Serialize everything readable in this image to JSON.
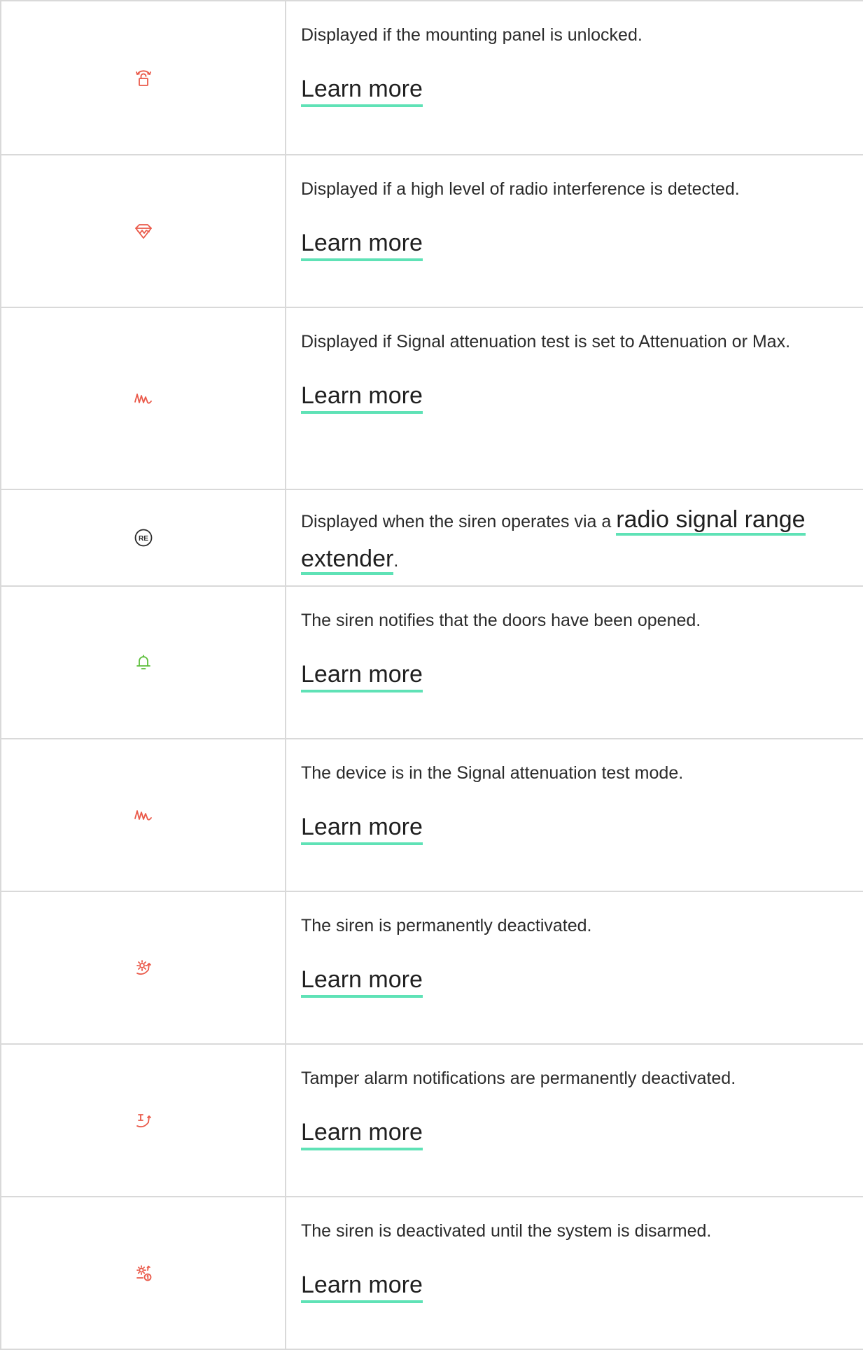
{
  "colors": {
    "accent_underline": "#5fe2b6",
    "icon_red": "#ea5a4a",
    "icon_green": "#5cbf3a",
    "icon_dark": "#2b2b2b",
    "border": "#d9d9d9"
  },
  "rows": [
    {
      "icon": "unlocked-mounting-panel-icon",
      "description": "Displayed if the mounting panel is unlocked.",
      "link": "Learn more"
    },
    {
      "icon": "radio-interference-icon",
      "description": "Displayed if a high level of radio interference is detected.",
      "link": "Learn more"
    },
    {
      "icon": "signal-attenuation-icon",
      "description": "Displayed if Signal attenuation test is set to Attenuation or Max.",
      "link": "Learn more"
    },
    {
      "icon": "range-extender-icon",
      "icon_text": "RE",
      "description_prefix": "Displayed when the siren operates via a ",
      "description_link": "radio signal range extender",
      "description_suffix": "."
    },
    {
      "icon": "door-chime-bell-icon",
      "description": "The siren notifies that the doors have been opened.",
      "link": "Learn more"
    },
    {
      "icon": "signal-attenuation-test-icon",
      "description": "The device is in the Signal attenuation test mode.",
      "link": "Learn more"
    },
    {
      "icon": "permanently-deactivated-icon",
      "description": "The siren is permanently deactivated.",
      "link": "Learn more"
    },
    {
      "icon": "tamper-deactivated-icon",
      "description": "Tamper alarm notifications are permanently deactivated.",
      "link": "Learn more"
    },
    {
      "icon": "deactivated-until-disarm-icon",
      "description": "The siren is deactivated until the system is disarmed.",
      "link": "Learn more"
    }
  ]
}
